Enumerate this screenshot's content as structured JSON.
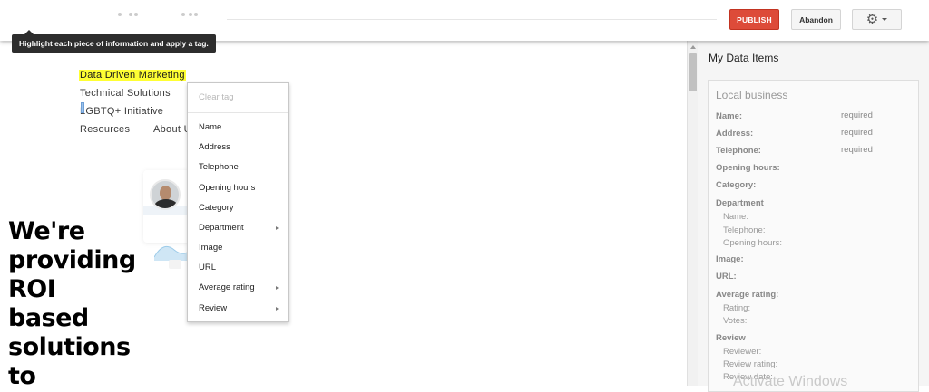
{
  "toolbar": {
    "publish_label": "PUBLISH",
    "abandon_label": "Abandon",
    "settings_icon": "gear-icon",
    "tooltip": "Highlight each piece of information and apply a tag.",
    "colors": {
      "publish": "#dd4b39"
    }
  },
  "page": {
    "nav": [
      "Data Driven Marketing",
      "Technical Solutions",
      "LGBTQ+ Initiative",
      "Resources",
      "About U"
    ],
    "hero_lines": [
      "We're",
      "providing",
      "ROI",
      "based",
      "solutions",
      "to"
    ],
    "highlight_color": "#ffff33"
  },
  "context_menu": {
    "clear_label": "Clear tag",
    "items": [
      {
        "label": "Name",
        "submenu": false
      },
      {
        "label": "Address",
        "submenu": false
      },
      {
        "label": "Telephone",
        "submenu": false
      },
      {
        "label": "Opening hours",
        "submenu": false
      },
      {
        "label": "Category",
        "submenu": false
      },
      {
        "label": "Department",
        "submenu": true
      },
      {
        "label": "Image",
        "submenu": false
      },
      {
        "label": "URL",
        "submenu": false
      },
      {
        "label": "Average rating",
        "submenu": true
      },
      {
        "label": "Review",
        "submenu": true
      }
    ]
  },
  "panel": {
    "title": "My Data Items",
    "box_title": "Local business",
    "fields": {
      "name": "Name:",
      "address": "Address:",
      "telephone": "Telephone:",
      "opening_hours": "Opening hours:",
      "category": "Category:",
      "department": "Department",
      "dept_name": "Name:",
      "dept_telephone": "Telephone:",
      "dept_opening_hours": "Opening hours:",
      "image": "Image:",
      "url": "URL:",
      "average_rating": "Average rating:",
      "rating": "Rating:",
      "votes": "Votes:",
      "review": "Review",
      "reviewer": "Reviewer:",
      "review_rating": "Review rating:",
      "review_date": "Review date:"
    },
    "required_label": "required"
  },
  "watermark": "Activate Windows"
}
